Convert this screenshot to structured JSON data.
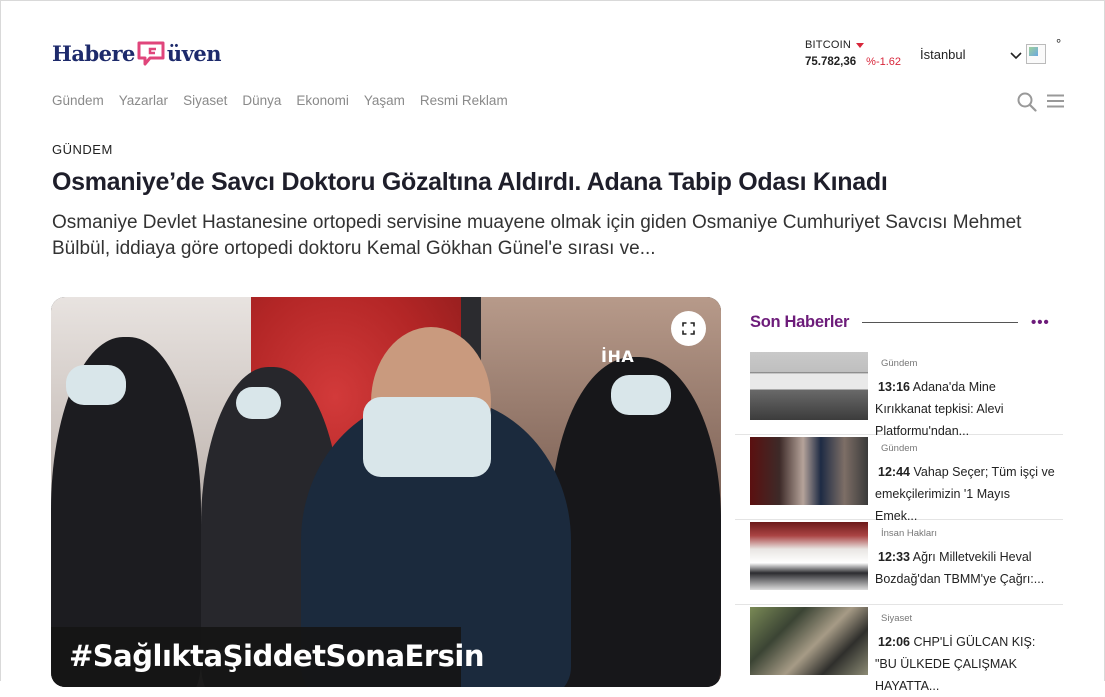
{
  "site": {
    "logo_left": "Habere",
    "logo_right": "üven"
  },
  "ticker": {
    "name": "BITCOIN",
    "price": "75.782,36",
    "change": "%-1.62",
    "down_color": "#d8263a"
  },
  "weather": {
    "city": "İstanbul",
    "degree": "°"
  },
  "nav": {
    "items": [
      "Gündem",
      "Yazarlar",
      "Siyaset",
      "Dünya",
      "Ekonomi",
      "Yaşam",
      "Resmi Reklam"
    ]
  },
  "article": {
    "category": "GÜNDEM",
    "title": "Osmaniye’de Savcı Doktoru Gözaltına Aldırdı. Adana Tabip Odası Kınadı",
    "summary": "Osmaniye Devlet Hastanesine ortopedi servisine muayene olmak için giden Osmaniye Cumhuriyet Savcısı Mehmet Bülbül, iddiaya göre ortopedi doktoru Kemal Gökhan Günel'e sırası ve...",
    "image_watermark": "İHA",
    "image_hashtag": "#SağlıktaŞiddetSonaErsin"
  },
  "sidebar": {
    "heading": "Son Haberler",
    "accent_color": "#6d1c7a",
    "items": [
      {
        "category": "Gündem",
        "time": "13:16",
        "text": "Adana'da Mine Kırıkkanat tepkisi: Alevi Platformu'ndan..."
      },
      {
        "category": "Gündem",
        "time": "12:44",
        "text": "Vahap Seçer; Tüm işçi ve emekçilerimizin '1 Mayıs Emek..."
      },
      {
        "category": "İnsan Hakları",
        "time": "12:33",
        "text": "Ağrı Milletvekili Heval Bozdağ'dan TBMM'ye Çağrı:..."
      },
      {
        "category": "Siyaset",
        "time": "12:06",
        "text": "CHP'Lİ GÜLCAN KIŞ: \"BU ÜLKEDE ÇALIŞMAK HAYATTA..."
      }
    ]
  }
}
